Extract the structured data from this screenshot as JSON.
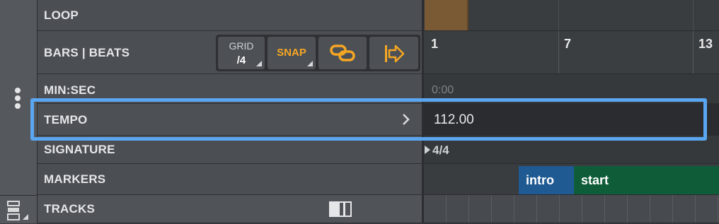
{
  "header": {
    "rows": {
      "loop": "LOOP",
      "bars_beats": "BARS | BEATS",
      "min_sec": "MIN:SEC",
      "tempo": "TEMPO",
      "signature": "SIGNATURE",
      "markers": "MARKERS",
      "tracks": "TRACKS"
    },
    "grid_label": "GRID",
    "grid_value": "/4",
    "snap_label": "SNAP"
  },
  "timeline": {
    "bar_numbers": [
      "1",
      "7",
      "13"
    ],
    "min_sec_value": "0:00",
    "tempo_value": "112.00",
    "signature_value": "4/4",
    "markers": [
      {
        "label": "intro",
        "color": "#1f5a92"
      },
      {
        "label": "start",
        "color": "#0f5c39"
      }
    ],
    "loop_color": "#7a5a34"
  },
  "colors": {
    "accent_orange": "#f5a623",
    "selection_blue": "#5aa6f0"
  }
}
